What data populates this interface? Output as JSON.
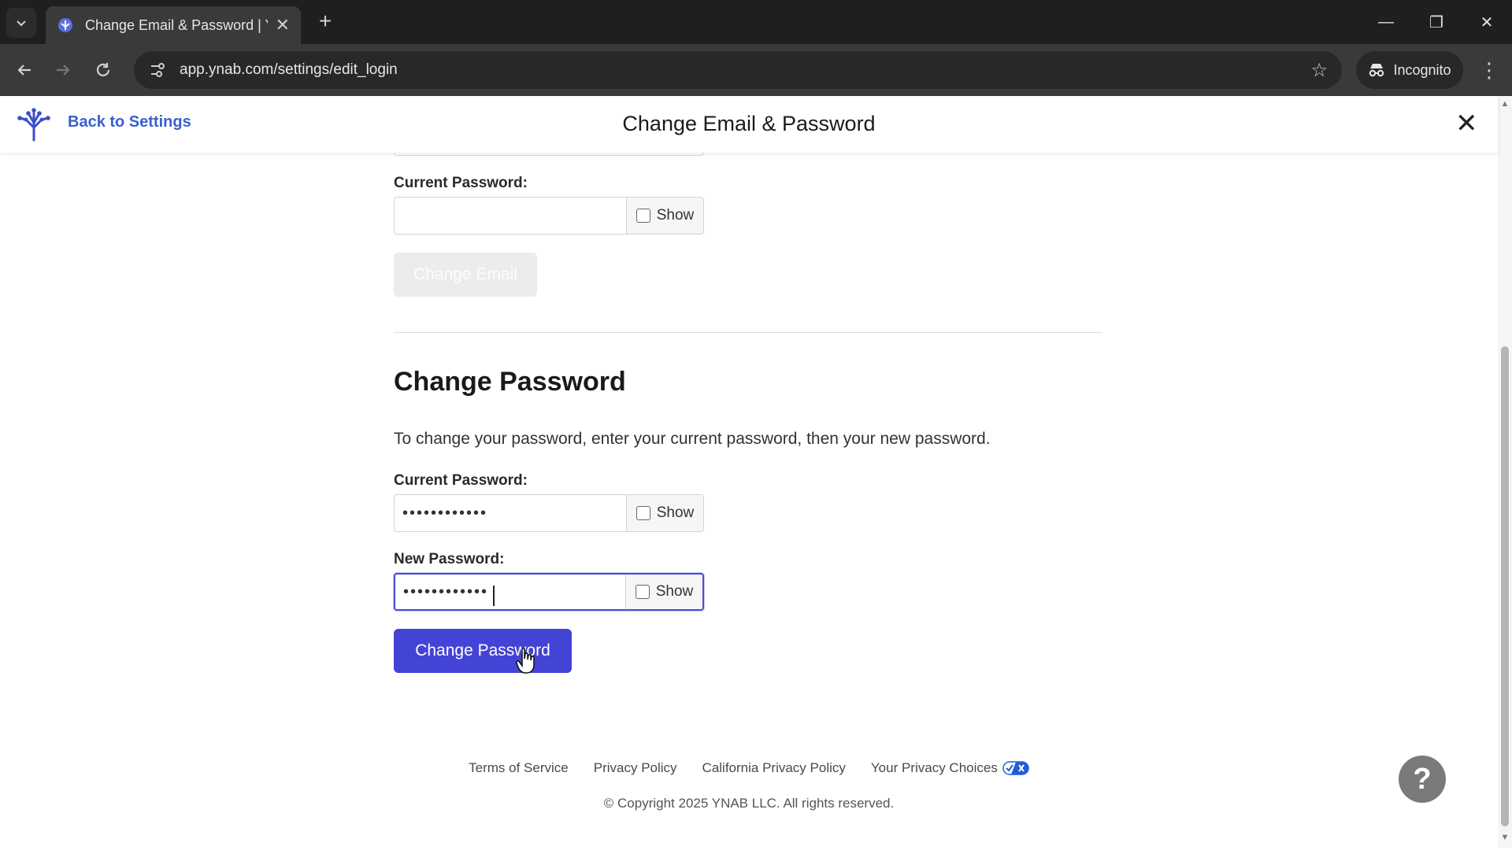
{
  "browser": {
    "tab_title": "Change Email & Password | YN",
    "new_tab_symbol": "+",
    "url": "app.ynab.com/settings/edit_login",
    "incognito_label": "Incognito"
  },
  "header": {
    "back_label": "Back to Settings",
    "title": "Change Email & Password",
    "close_symbol": "✕"
  },
  "email_section": {
    "current_password_label": "Current Password:",
    "current_password_value": "",
    "show_label": "Show",
    "change_email_button": "Change Email"
  },
  "password_section": {
    "heading": "Change Password",
    "description": "To change your password, enter your current password, then your new password.",
    "current_password_label": "Current Password:",
    "current_password_value": "••••••••••••",
    "new_password_label": "New Password:",
    "new_password_value": "••••••••••••",
    "show_label": "Show",
    "change_password_button": "Change Password"
  },
  "footer": {
    "links": [
      "Terms of Service",
      "Privacy Policy",
      "California Privacy Policy",
      "Your Privacy Choices"
    ],
    "copyright": "© Copyright 2025 YNAB LLC. All rights reserved."
  },
  "help": {
    "symbol": "?"
  },
  "colors": {
    "brand": "#4343d6",
    "link": "#3a5fcd",
    "focus_border": "#4b4bd8"
  },
  "icons": [
    "chevron-down-icon",
    "ynab-favicon-icon",
    "close-icon",
    "back-arrow-icon",
    "forward-arrow-icon",
    "reload-icon",
    "site-info-icon",
    "star-icon",
    "incognito-icon",
    "kebab-menu-icon",
    "ynab-logo-icon",
    "privacy-choices-icon",
    "help-icon"
  ]
}
